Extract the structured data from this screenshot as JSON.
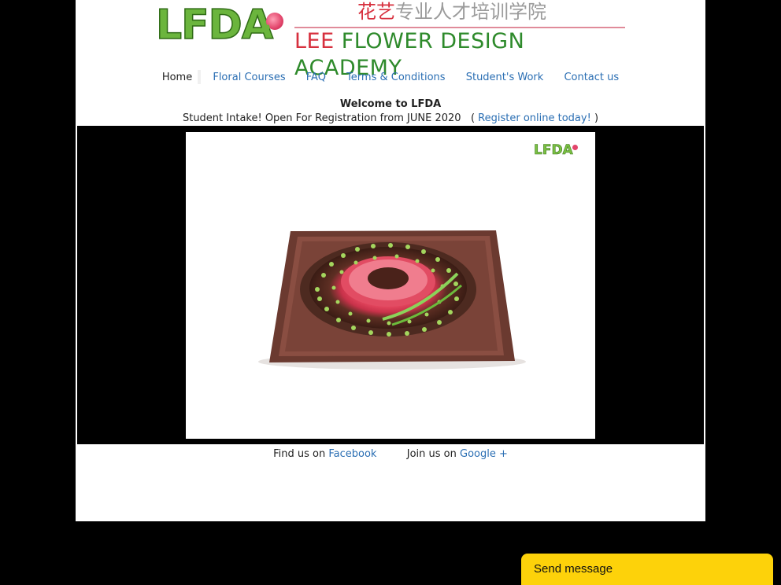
{
  "header": {
    "logo_text": "LFDA",
    "chinese_prefix": "花艺",
    "chinese_rest": "专业人才培训学院",
    "academy_prefix": "LEE",
    "academy_rest": "FLOWER DESIGN ACADEMY"
  },
  "nav": {
    "items": [
      {
        "label": "Home"
      },
      {
        "label": "Floral Courses"
      },
      {
        "label": "FAQ"
      },
      {
        "label": "Terms & Conditions"
      },
      {
        "label": "Student's Work"
      },
      {
        "label": "Contact us"
      }
    ]
  },
  "main": {
    "welcome": "Welcome to LFDA",
    "intake_text": "Student Intake! Open For Registration from JUNE 2020",
    "paren_open": "(",
    "register_link": "Register online today!",
    "paren_close": ")"
  },
  "slideshow": {
    "watermark": "LFDA"
  },
  "footer": {
    "find_text": "Find us on",
    "facebook_link": "Facebook",
    "join_text": "Join us on",
    "google_link": "Google +"
  },
  "chat": {
    "send_label": "Send message"
  },
  "colors": {
    "link": "#2a6eb3",
    "chat_accent": "#fdd20a",
    "brand_green": "#6bb53d",
    "brand_red": "#d7303e"
  }
}
